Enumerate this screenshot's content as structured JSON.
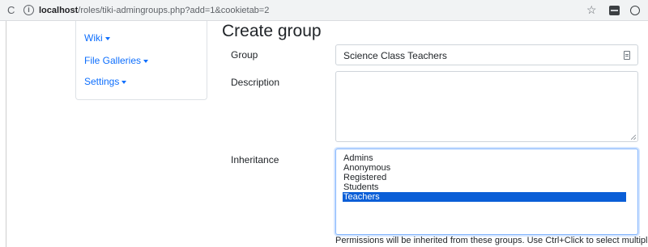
{
  "browser": {
    "url_host": "localhost",
    "url_path": "/roles/tiki-admingroups.php?add=1&cookietab=2"
  },
  "sidebar": {
    "items": [
      {
        "label": "Wiki"
      },
      {
        "label": "File Galleries"
      },
      {
        "label": "Settings"
      }
    ]
  },
  "main": {
    "title": "Create group",
    "group": {
      "label": "Group",
      "value": "Science Class Teachers"
    },
    "description": {
      "label": "Description",
      "value": ""
    },
    "inheritance": {
      "label": "Inheritance",
      "options": [
        "Admins",
        "Anonymous",
        "Registered",
        "Students",
        "Teachers"
      ],
      "selected": "Teachers",
      "help": "Permissions will be inherited from these groups. Use Ctrl+Click to select multiple"
    }
  },
  "colors": {
    "link": "#0d6efd",
    "selection": "#0a5ed7",
    "focus_border": "#86b7fe"
  }
}
